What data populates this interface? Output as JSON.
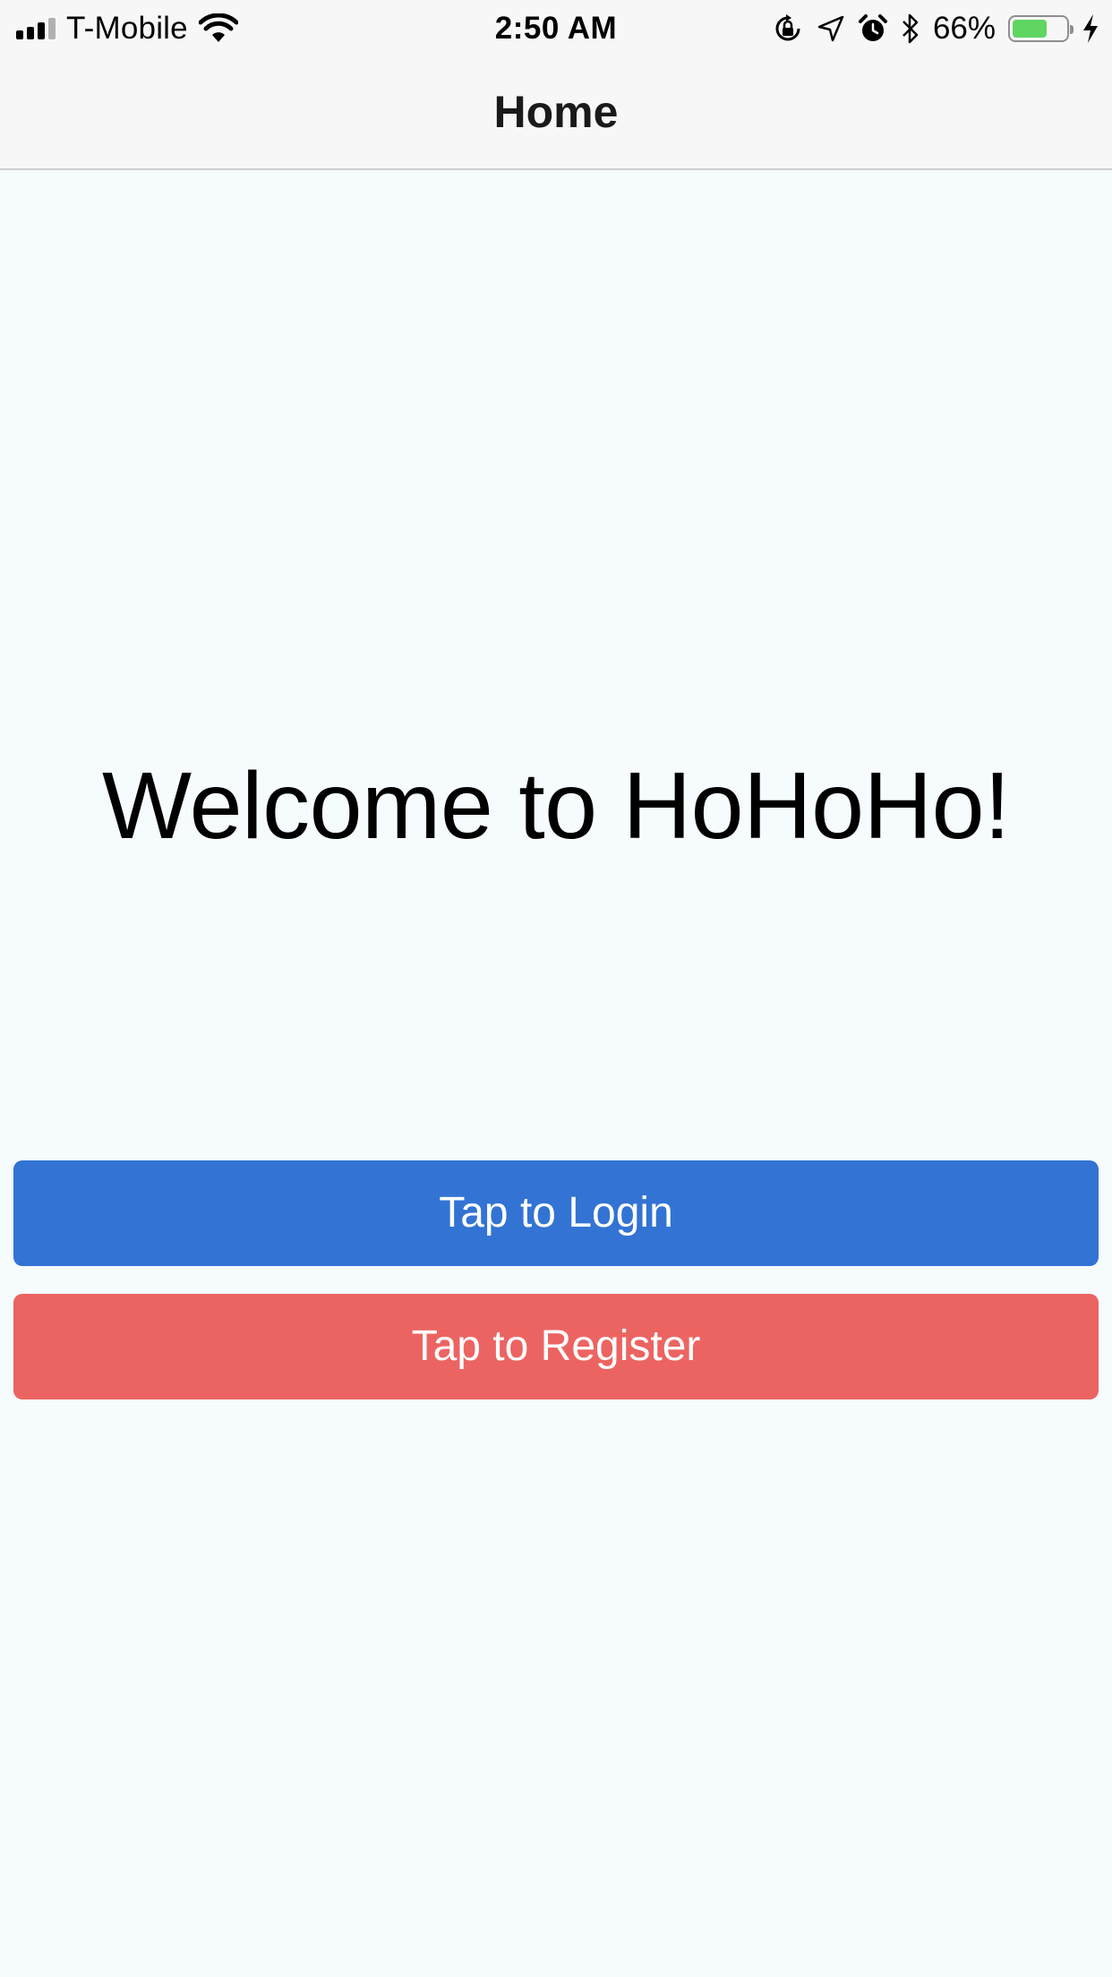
{
  "status_bar": {
    "carrier": "T-Mobile",
    "time": "2:50 AM",
    "battery_percent_text": "66%",
    "battery_level": 0.66,
    "icons": [
      "signal-icon",
      "wifi-icon",
      "orientation-lock-icon",
      "location-icon",
      "alarm-icon",
      "bluetooth-icon",
      "battery-icon",
      "charging-icon"
    ]
  },
  "nav": {
    "title": "Home"
  },
  "main": {
    "welcome": "Welcome to HoHoHo!",
    "login_label": "Tap to Login",
    "register_label": "Tap to Register"
  },
  "colors": {
    "background": "#f6fbfe",
    "login_button": "#3273d4",
    "register_button": "#ec6461",
    "battery_fill": "#5fd562"
  }
}
